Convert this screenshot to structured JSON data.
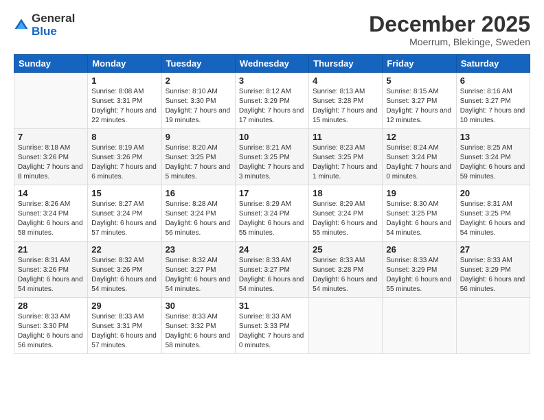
{
  "logo": {
    "general": "General",
    "blue": "Blue"
  },
  "header": {
    "month": "December 2025",
    "location": "Moerrum, Blekinge, Sweden"
  },
  "weekdays": [
    "Sunday",
    "Monday",
    "Tuesday",
    "Wednesday",
    "Thursday",
    "Friday",
    "Saturday"
  ],
  "weeks": [
    [
      {
        "day": "",
        "sunrise": "",
        "sunset": "",
        "daylight": ""
      },
      {
        "day": "1",
        "sunrise": "Sunrise: 8:08 AM",
        "sunset": "Sunset: 3:31 PM",
        "daylight": "Daylight: 7 hours and 22 minutes."
      },
      {
        "day": "2",
        "sunrise": "Sunrise: 8:10 AM",
        "sunset": "Sunset: 3:30 PM",
        "daylight": "Daylight: 7 hours and 19 minutes."
      },
      {
        "day": "3",
        "sunrise": "Sunrise: 8:12 AM",
        "sunset": "Sunset: 3:29 PM",
        "daylight": "Daylight: 7 hours and 17 minutes."
      },
      {
        "day": "4",
        "sunrise": "Sunrise: 8:13 AM",
        "sunset": "Sunset: 3:28 PM",
        "daylight": "Daylight: 7 hours and 15 minutes."
      },
      {
        "day": "5",
        "sunrise": "Sunrise: 8:15 AM",
        "sunset": "Sunset: 3:27 PM",
        "daylight": "Daylight: 7 hours and 12 minutes."
      },
      {
        "day": "6",
        "sunrise": "Sunrise: 8:16 AM",
        "sunset": "Sunset: 3:27 PM",
        "daylight": "Daylight: 7 hours and 10 minutes."
      }
    ],
    [
      {
        "day": "7",
        "sunrise": "Sunrise: 8:18 AM",
        "sunset": "Sunset: 3:26 PM",
        "daylight": "Daylight: 7 hours and 8 minutes."
      },
      {
        "day": "8",
        "sunrise": "Sunrise: 8:19 AM",
        "sunset": "Sunset: 3:26 PM",
        "daylight": "Daylight: 7 hours and 6 minutes."
      },
      {
        "day": "9",
        "sunrise": "Sunrise: 8:20 AM",
        "sunset": "Sunset: 3:25 PM",
        "daylight": "Daylight: 7 hours and 5 minutes."
      },
      {
        "day": "10",
        "sunrise": "Sunrise: 8:21 AM",
        "sunset": "Sunset: 3:25 PM",
        "daylight": "Daylight: 7 hours and 3 minutes."
      },
      {
        "day": "11",
        "sunrise": "Sunrise: 8:23 AM",
        "sunset": "Sunset: 3:25 PM",
        "daylight": "Daylight: 7 hours and 1 minute."
      },
      {
        "day": "12",
        "sunrise": "Sunrise: 8:24 AM",
        "sunset": "Sunset: 3:24 PM",
        "daylight": "Daylight: 7 hours and 0 minutes."
      },
      {
        "day": "13",
        "sunrise": "Sunrise: 8:25 AM",
        "sunset": "Sunset: 3:24 PM",
        "daylight": "Daylight: 6 hours and 59 minutes."
      }
    ],
    [
      {
        "day": "14",
        "sunrise": "Sunrise: 8:26 AM",
        "sunset": "Sunset: 3:24 PM",
        "daylight": "Daylight: 6 hours and 58 minutes."
      },
      {
        "day": "15",
        "sunrise": "Sunrise: 8:27 AM",
        "sunset": "Sunset: 3:24 PM",
        "daylight": "Daylight: 6 hours and 57 minutes."
      },
      {
        "day": "16",
        "sunrise": "Sunrise: 8:28 AM",
        "sunset": "Sunset: 3:24 PM",
        "daylight": "Daylight: 6 hours and 56 minutes."
      },
      {
        "day": "17",
        "sunrise": "Sunrise: 8:29 AM",
        "sunset": "Sunset: 3:24 PM",
        "daylight": "Daylight: 6 hours and 55 minutes."
      },
      {
        "day": "18",
        "sunrise": "Sunrise: 8:29 AM",
        "sunset": "Sunset: 3:24 PM",
        "daylight": "Daylight: 6 hours and 55 minutes."
      },
      {
        "day": "19",
        "sunrise": "Sunrise: 8:30 AM",
        "sunset": "Sunset: 3:25 PM",
        "daylight": "Daylight: 6 hours and 54 minutes."
      },
      {
        "day": "20",
        "sunrise": "Sunrise: 8:31 AM",
        "sunset": "Sunset: 3:25 PM",
        "daylight": "Daylight: 6 hours and 54 minutes."
      }
    ],
    [
      {
        "day": "21",
        "sunrise": "Sunrise: 8:31 AM",
        "sunset": "Sunset: 3:26 PM",
        "daylight": "Daylight: 6 hours and 54 minutes."
      },
      {
        "day": "22",
        "sunrise": "Sunrise: 8:32 AM",
        "sunset": "Sunset: 3:26 PM",
        "daylight": "Daylight: 6 hours and 54 minutes."
      },
      {
        "day": "23",
        "sunrise": "Sunrise: 8:32 AM",
        "sunset": "Sunset: 3:27 PM",
        "daylight": "Daylight: 6 hours and 54 minutes."
      },
      {
        "day": "24",
        "sunrise": "Sunrise: 8:33 AM",
        "sunset": "Sunset: 3:27 PM",
        "daylight": "Daylight: 6 hours and 54 minutes."
      },
      {
        "day": "25",
        "sunrise": "Sunrise: 8:33 AM",
        "sunset": "Sunset: 3:28 PM",
        "daylight": "Daylight: 6 hours and 54 minutes."
      },
      {
        "day": "26",
        "sunrise": "Sunrise: 8:33 AM",
        "sunset": "Sunset: 3:29 PM",
        "daylight": "Daylight: 6 hours and 55 minutes."
      },
      {
        "day": "27",
        "sunrise": "Sunrise: 8:33 AM",
        "sunset": "Sunset: 3:29 PM",
        "daylight": "Daylight: 6 hours and 56 minutes."
      }
    ],
    [
      {
        "day": "28",
        "sunrise": "Sunrise: 8:33 AM",
        "sunset": "Sunset: 3:30 PM",
        "daylight": "Daylight: 6 hours and 56 minutes."
      },
      {
        "day": "29",
        "sunrise": "Sunrise: 8:33 AM",
        "sunset": "Sunset: 3:31 PM",
        "daylight": "Daylight: 6 hours and 57 minutes."
      },
      {
        "day": "30",
        "sunrise": "Sunrise: 8:33 AM",
        "sunset": "Sunset: 3:32 PM",
        "daylight": "Daylight: 6 hours and 58 minutes."
      },
      {
        "day": "31",
        "sunrise": "Sunrise: 8:33 AM",
        "sunset": "Sunset: 3:33 PM",
        "daylight": "Daylight: 7 hours and 0 minutes."
      },
      {
        "day": "",
        "sunrise": "",
        "sunset": "",
        "daylight": ""
      },
      {
        "day": "",
        "sunrise": "",
        "sunset": "",
        "daylight": ""
      },
      {
        "day": "",
        "sunrise": "",
        "sunset": "",
        "daylight": ""
      }
    ]
  ]
}
